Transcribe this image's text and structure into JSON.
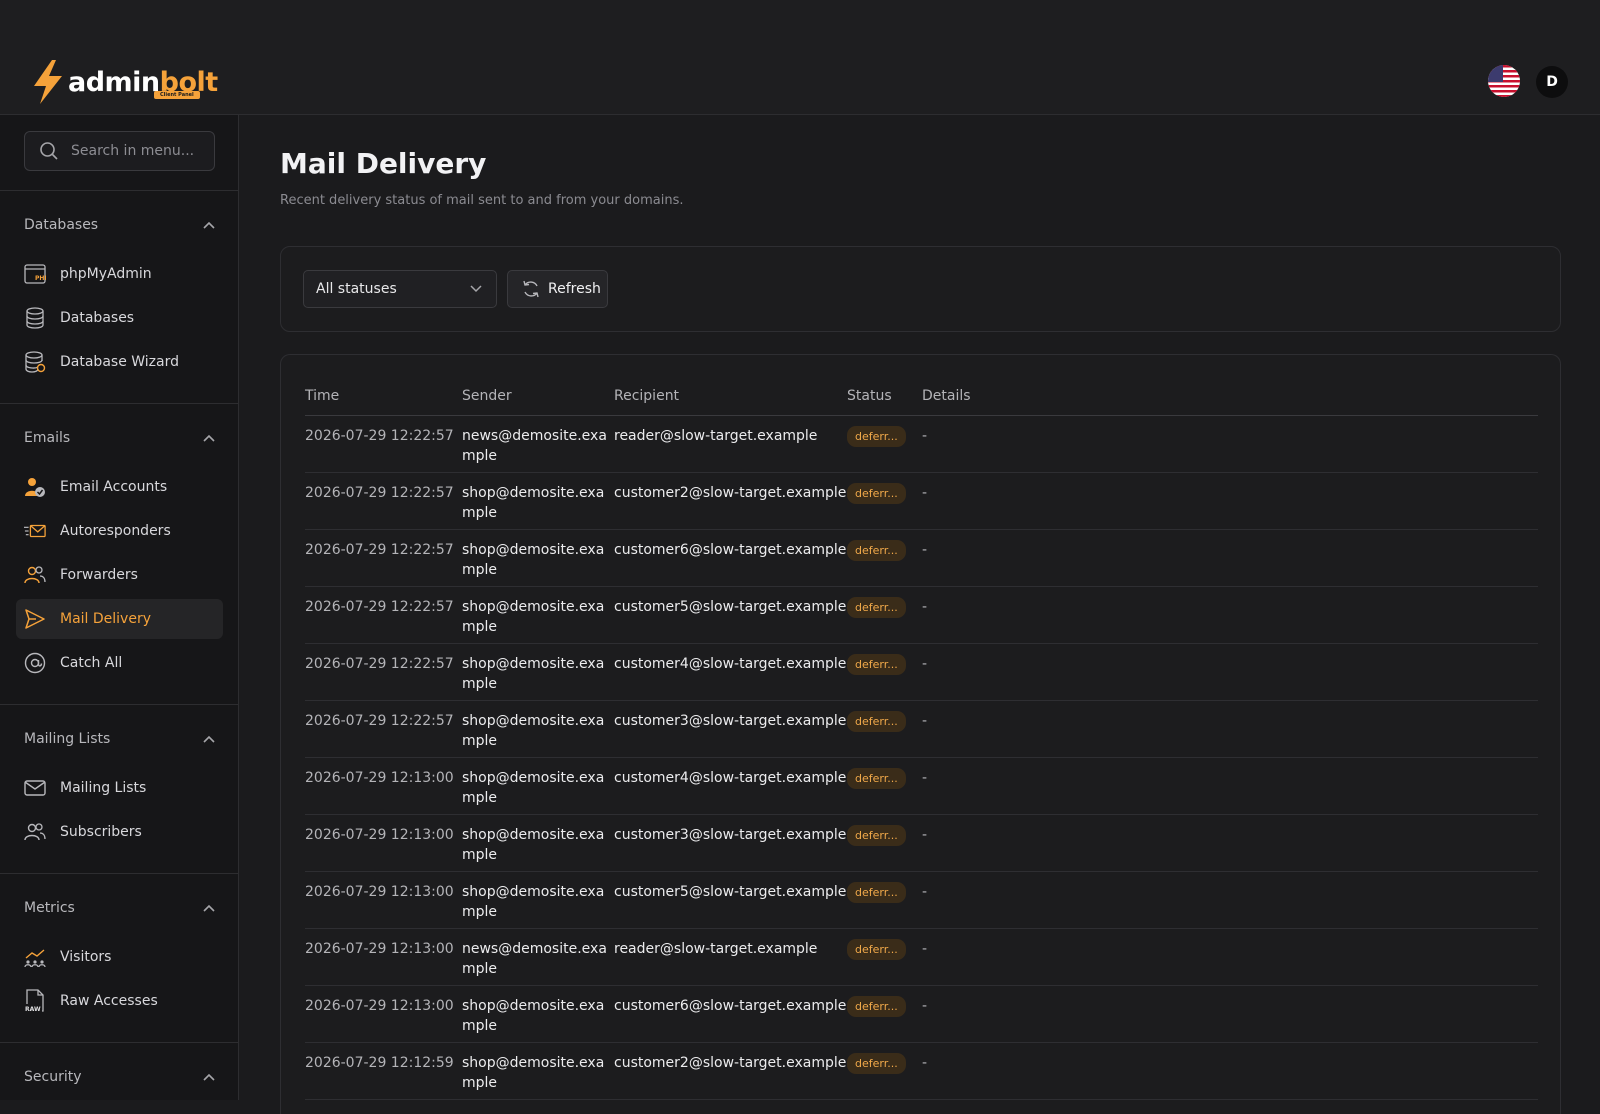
{
  "brand": {
    "name_part1": "admin",
    "name_part2": "bolt",
    "badge": "Client Panel",
    "bolt_color": "#f5a23a"
  },
  "header": {
    "flag_icon": "us-flag-icon",
    "avatar_initial": "D"
  },
  "sidebar": {
    "search_placeholder": "Search in menu...",
    "sections": [
      {
        "title": "Databases",
        "items": [
          {
            "label": "phpMyAdmin",
            "icon": "phpmyadmin-icon"
          },
          {
            "label": "Databases",
            "icon": "database-icon"
          },
          {
            "label": "Database Wizard",
            "icon": "database-wizard-icon"
          }
        ]
      },
      {
        "title": "Emails",
        "items": [
          {
            "label": "Email Accounts",
            "icon": "email-account-icon"
          },
          {
            "label": "Autoresponders",
            "icon": "autoresponder-icon"
          },
          {
            "label": "Forwarders",
            "icon": "forwarders-icon"
          },
          {
            "label": "Mail Delivery",
            "icon": "send-icon",
            "active": true
          },
          {
            "label": "Catch All",
            "icon": "at-icon"
          }
        ]
      },
      {
        "title": "Mailing Lists",
        "items": [
          {
            "label": "Mailing Lists",
            "icon": "mail-icon"
          },
          {
            "label": "Subscribers",
            "icon": "subscribers-icon"
          }
        ]
      },
      {
        "title": "Metrics",
        "items": [
          {
            "label": "Visitors",
            "icon": "visitors-icon"
          },
          {
            "label": "Raw Accesses",
            "icon": "raw-file-icon"
          }
        ]
      },
      {
        "title": "Security",
        "items": []
      }
    ]
  },
  "main": {
    "title": "Mail Delivery",
    "subtitle": "Recent delivery status of mail sent to and from your domains.",
    "filter": {
      "selected": "All statuses"
    },
    "refresh_label": "Refresh",
    "table": {
      "headers": [
        "Time",
        "Sender",
        "Recipient",
        "Status",
        "Details"
      ],
      "rows": [
        [
          "2026-07-29 12:22:57",
          "news@demosite.example",
          "reader@slow-target.example",
          "deferr...",
          "-"
        ],
        [
          "2026-07-29 12:22:57",
          "shop@demosite.example",
          "customer2@slow-target.example",
          "deferr...",
          "-"
        ],
        [
          "2026-07-29 12:22:57",
          "shop@demosite.example",
          "customer6@slow-target.example",
          "deferr...",
          "-"
        ],
        [
          "2026-07-29 12:22:57",
          "shop@demosite.example",
          "customer5@slow-target.example",
          "deferr...",
          "-"
        ],
        [
          "2026-07-29 12:22:57",
          "shop@demosite.example",
          "customer4@slow-target.example",
          "deferr...",
          "-"
        ],
        [
          "2026-07-29 12:22:57",
          "shop@demosite.example",
          "customer3@slow-target.example",
          "deferr...",
          "-"
        ],
        [
          "2026-07-29 12:13:00",
          "shop@demosite.example",
          "customer4@slow-target.example",
          "deferr...",
          "-"
        ],
        [
          "2026-07-29 12:13:00",
          "shop@demosite.example",
          "customer3@slow-target.example",
          "deferr...",
          "-"
        ],
        [
          "2026-07-29 12:13:00",
          "shop@demosite.example",
          "customer5@slow-target.example",
          "deferr...",
          "-"
        ],
        [
          "2026-07-29 12:13:00",
          "news@demosite.example",
          "reader@slow-target.example",
          "deferr...",
          "-"
        ],
        [
          "2026-07-29 12:13:00",
          "shop@demosite.example",
          "customer6@slow-target.example",
          "deferr...",
          "-"
        ],
        [
          "2026-07-29 12:12:59",
          "shop@demosite.example",
          "customer2@slow-target.example",
          "deferr...",
          "-"
        ]
      ]
    }
  }
}
